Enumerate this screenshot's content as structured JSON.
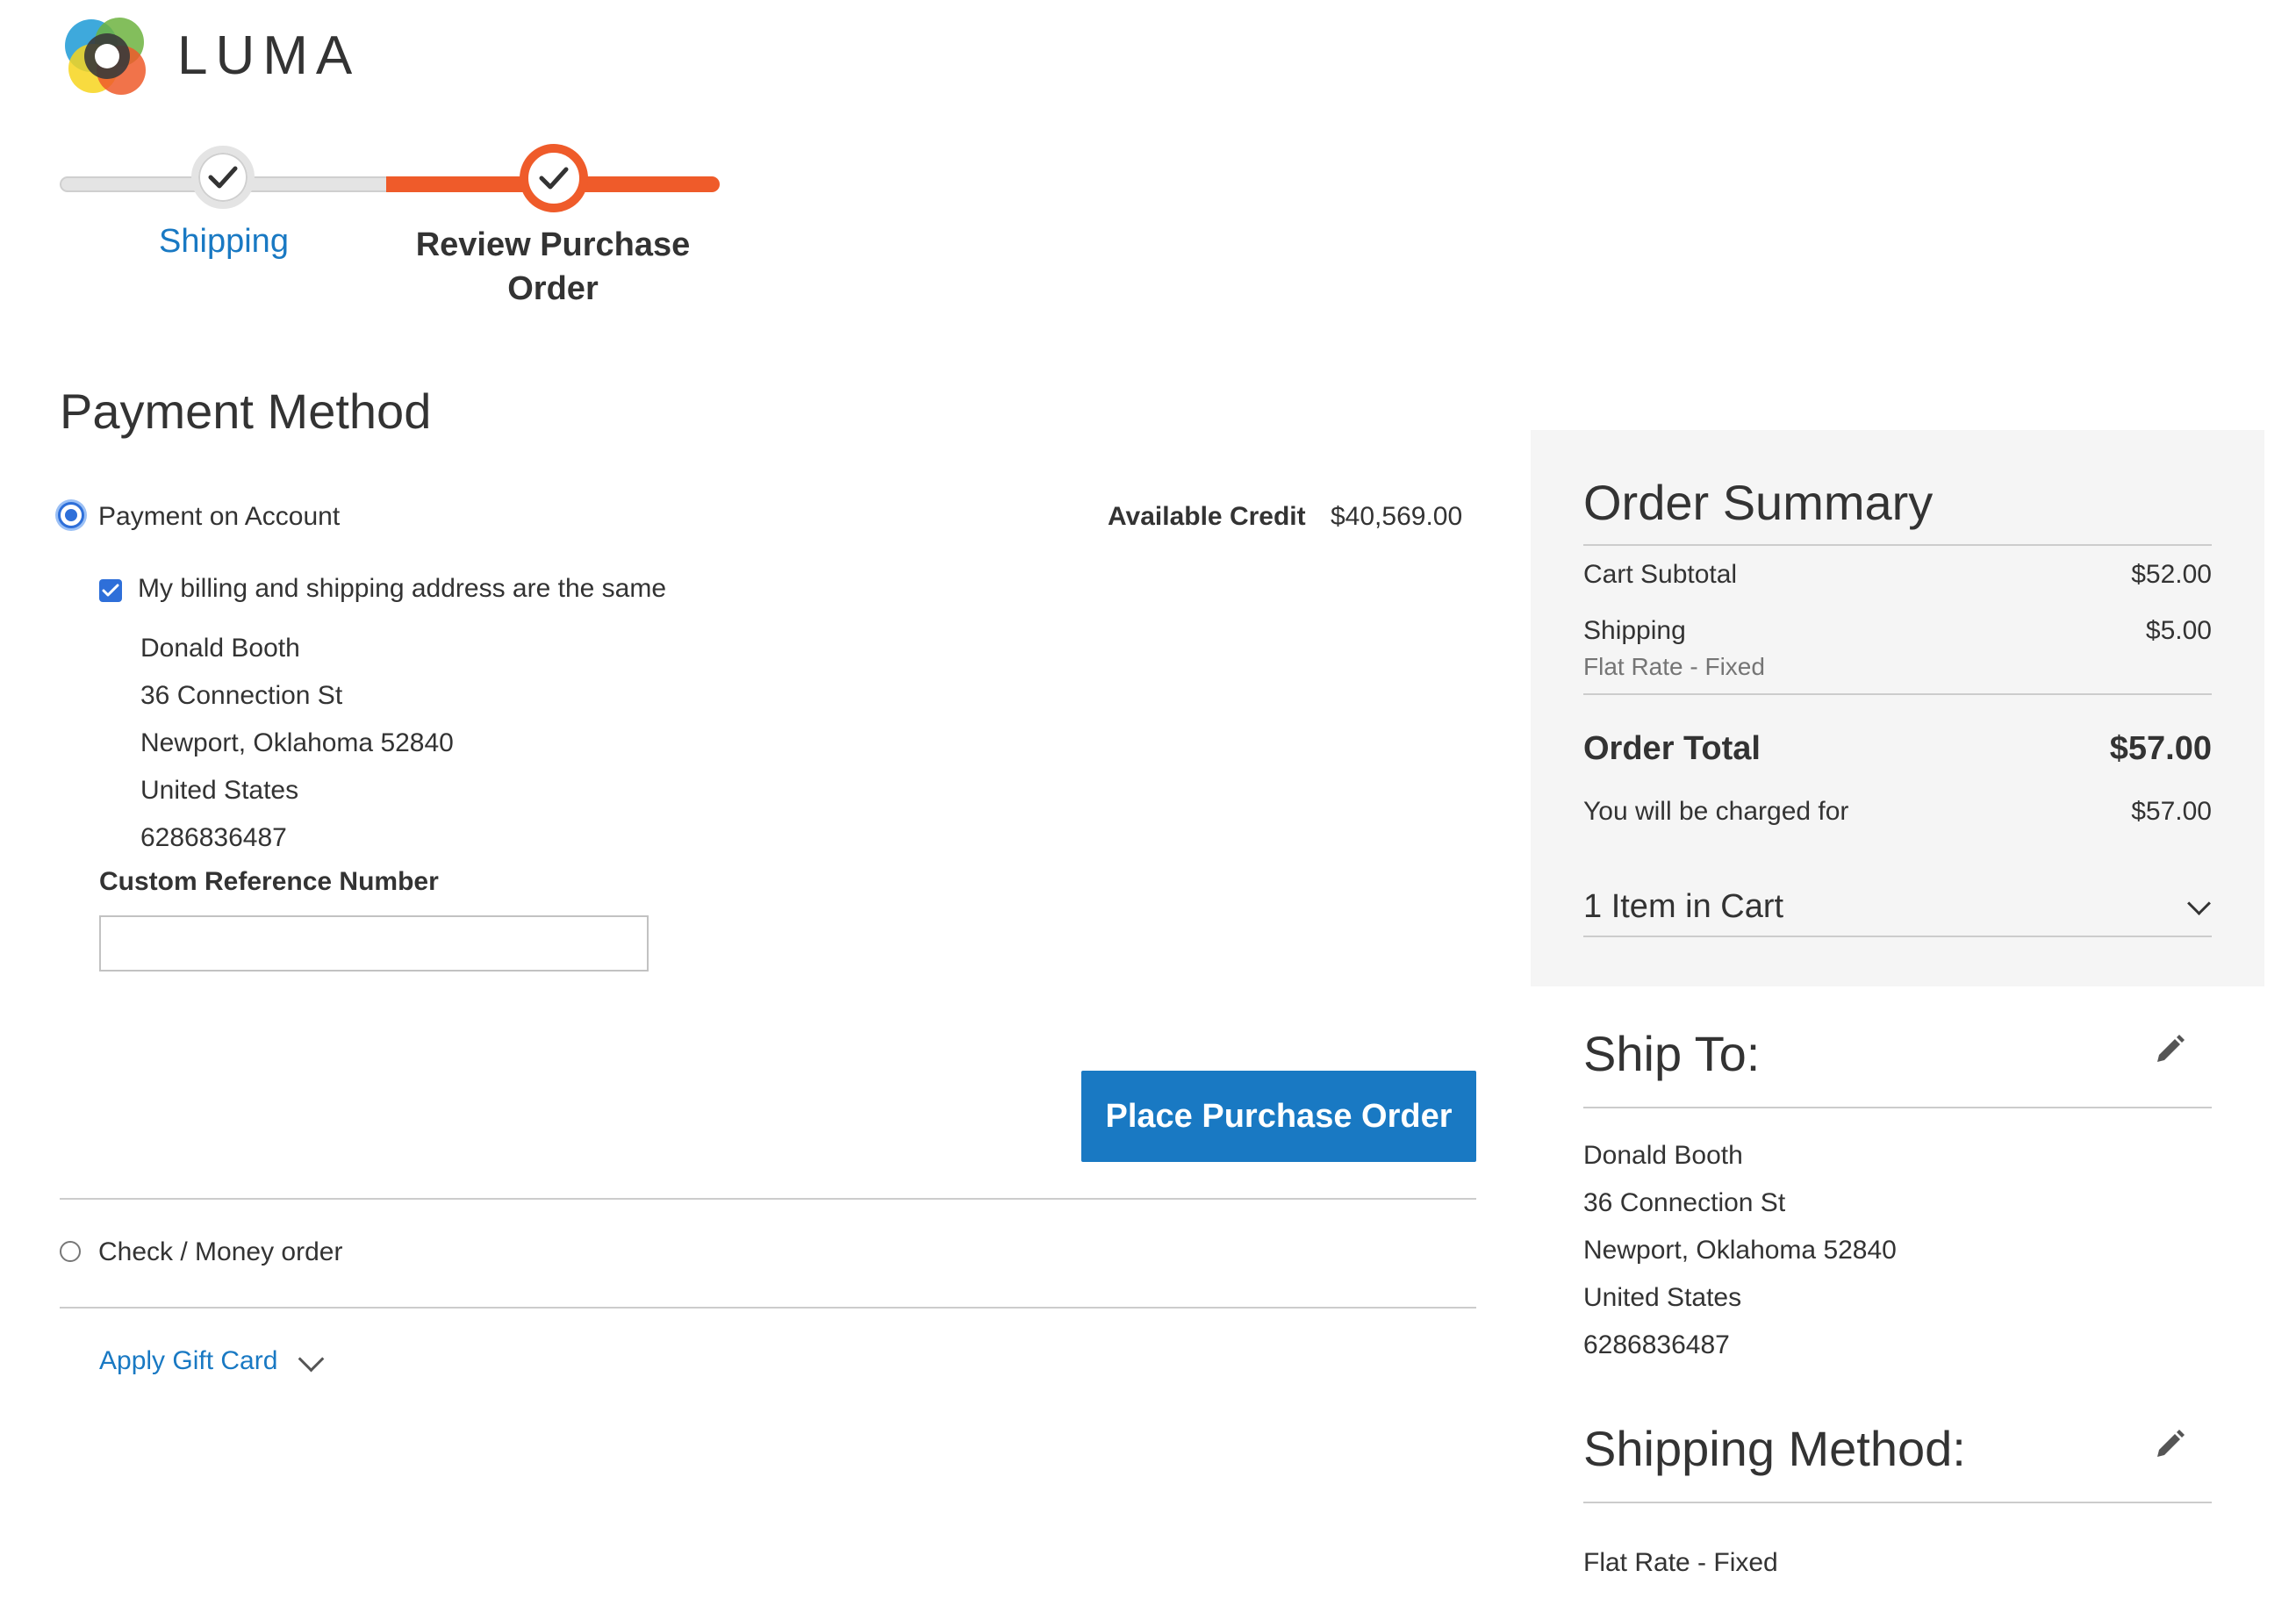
{
  "brand": {
    "name": "LUMA",
    "colors": {
      "accent": "#ef5b2a",
      "link": "#1979c3",
      "button": "#1979c3"
    }
  },
  "progress": {
    "steps": [
      {
        "label": "Shipping",
        "state": "complete",
        "icon": "checkmark-icon"
      },
      {
        "label": "Review Purchase Order",
        "label_line1": "Review Purchase",
        "label_line2": "Order",
        "state": "active",
        "icon": "checkmark-icon"
      }
    ]
  },
  "payment": {
    "title": "Payment Method",
    "methods": [
      {
        "label": "Payment on Account",
        "selected": true
      },
      {
        "label": "Check / Money order",
        "selected": false
      }
    ],
    "available_credit_label": "Available Credit",
    "available_credit_value": "$40,569.00",
    "same_address_label": "My billing and shipping address are the same",
    "same_address_checked": true,
    "billing_address": {
      "name": "Donald Booth",
      "street": "36 Connection St",
      "city_line": "Newport, Oklahoma 52840",
      "country": "United States",
      "phone": "6286836487"
    },
    "custom_reference_label": "Custom Reference Number",
    "custom_reference_value": "",
    "place_order_label": "Place Purchase Order",
    "gift_card_label": "Apply Gift Card"
  },
  "summary": {
    "title": "Order Summary",
    "cart_subtotal_label": "Cart Subtotal",
    "cart_subtotal_value": "$52.00",
    "shipping_label": "Shipping",
    "shipping_value": "$5.00",
    "shipping_method": "Flat Rate - Fixed",
    "order_total_label": "Order Total",
    "order_total_value": "$57.00",
    "charged_label": "You will be charged for",
    "charged_value": "$57.00",
    "items_label": "1 Item in Cart"
  },
  "ship_to": {
    "title": "Ship To:",
    "name": "Donald Booth",
    "street": "36 Connection St",
    "city_line": "Newport, Oklahoma 52840",
    "country": "United States",
    "phone": "6286836487"
  },
  "shipping_method": {
    "title": "Shipping Method:",
    "value": "Flat Rate - Fixed"
  }
}
